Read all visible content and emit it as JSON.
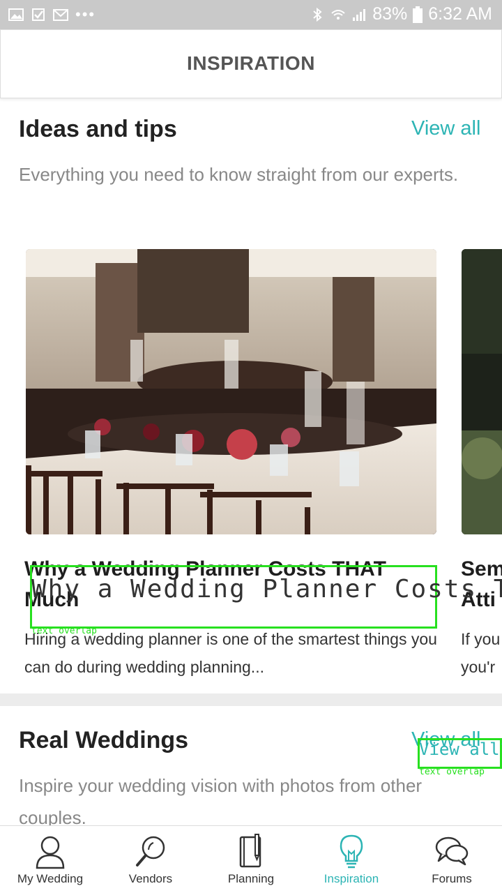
{
  "status_bar": {
    "battery": "83%",
    "time": "6:32 AM"
  },
  "header": {
    "title": "INSPIRATION"
  },
  "ideas": {
    "title": "Ideas and tips",
    "view_all": "View all",
    "subtitle": "Everything you need to know straight from our experts.",
    "cards": [
      {
        "title": "Why a Wedding Planner Costs THAT Much",
        "description": "Hiring a wedding planner is one of the smartest things you can do during wedding planning..."
      },
      {
        "title": "Sem",
        "title_line2": "Atti",
        "description": "If you",
        "description_line2": "you'r"
      }
    ]
  },
  "real_weddings": {
    "title": "Real Weddings",
    "view_all": "View all",
    "subtitle": "Inspire your wedding vision with photos from other couples."
  },
  "overlays": [
    {
      "text": "Why a Wedding Planner Costs THAT?M",
      "label": "text overlap"
    },
    {
      "text": "View all?",
      "label": "text overlap"
    }
  ],
  "bottom_nav": [
    {
      "label": "My Wedding",
      "icon": "person-icon"
    },
    {
      "label": "Vendors",
      "icon": "magnifier-icon"
    },
    {
      "label": "Planning",
      "icon": "notebook-icon"
    },
    {
      "label": "Inspiration",
      "icon": "lightbulb-icon",
      "active": true
    },
    {
      "label": "Forums",
      "icon": "chat-bubbles-icon"
    }
  ],
  "colors": {
    "accent": "#2cb4b4",
    "status_bar": "#c9c9c9",
    "overlay": "#27e01f"
  }
}
